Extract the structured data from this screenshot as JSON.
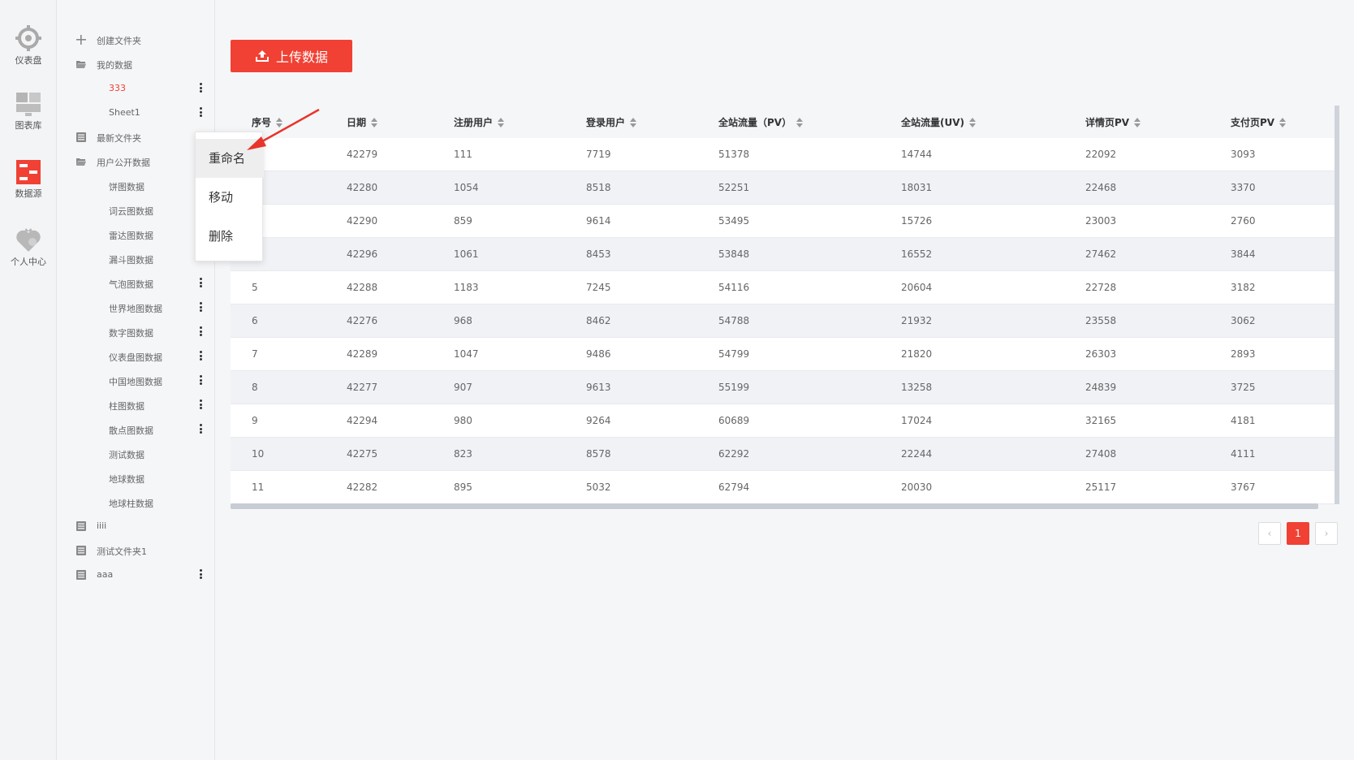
{
  "rail": {
    "items": [
      {
        "label": "仪表盘",
        "icon": "dashboard-icon"
      },
      {
        "label": "图表库",
        "icon": "chart-library-icon"
      },
      {
        "label": "数据源",
        "icon": "data-source-icon"
      },
      {
        "label": "个人中心",
        "icon": "user-center-icon"
      }
    ]
  },
  "tree": {
    "create_folder": "创建文件夹",
    "items": [
      {
        "label": "我的数据",
        "kind": "folder"
      },
      {
        "label": "333",
        "kind": "file"
      },
      {
        "label": "Sheet1",
        "kind": "file"
      },
      {
        "label": "最新文件夹",
        "kind": "list"
      },
      {
        "label": "用户公开数据",
        "kind": "folder"
      },
      {
        "label": "饼图数据",
        "kind": "file"
      },
      {
        "label": "词云图数据",
        "kind": "file"
      },
      {
        "label": "雷达图数据",
        "kind": "file"
      },
      {
        "label": "漏斗图数据",
        "kind": "file"
      },
      {
        "label": "气泡图数据",
        "kind": "file"
      },
      {
        "label": "世界地图数据",
        "kind": "file"
      },
      {
        "label": "数字图数据",
        "kind": "file"
      },
      {
        "label": "仪表盘图数据",
        "kind": "file"
      },
      {
        "label": "中国地图数据",
        "kind": "file"
      },
      {
        "label": "柱图数据",
        "kind": "file"
      },
      {
        "label": "散点图数据",
        "kind": "file"
      },
      {
        "label": "测试数据",
        "kind": "file"
      },
      {
        "label": "地球数据",
        "kind": "file"
      },
      {
        "label": "地球柱数据",
        "kind": "file"
      },
      {
        "label": "iiii",
        "kind": "list"
      },
      {
        "label": "测试文件夹1",
        "kind": "list"
      },
      {
        "label": "aaa",
        "kind": "list"
      }
    ]
  },
  "context_menu": {
    "items": [
      "重命名",
      "移动",
      "删除"
    ]
  },
  "upload": {
    "label": "上传数据"
  },
  "table": {
    "headers": [
      "序号",
      "日期",
      "注册用户",
      "登录用户",
      "全站流量（PV）",
      "全站流量(UV)",
      "详情页PV",
      "支付页PV"
    ],
    "rows": [
      [
        "",
        "42279",
        "111",
        "7719",
        "51378",
        "14744",
        "22092",
        "3093"
      ],
      [
        "",
        "42280",
        "1054",
        "8518",
        "52251",
        "18031",
        "22468",
        "3370"
      ],
      [
        "",
        "42290",
        "859",
        "9614",
        "53495",
        "15726",
        "23003",
        "2760"
      ],
      [
        "",
        "42296",
        "1061",
        "8453",
        "53848",
        "16552",
        "27462",
        "3844"
      ],
      [
        "5",
        "42288",
        "1183",
        "7245",
        "54116",
        "20604",
        "22728",
        "3182"
      ],
      [
        "6",
        "42276",
        "968",
        "8462",
        "54788",
        "21932",
        "23558",
        "3062"
      ],
      [
        "7",
        "42289",
        "1047",
        "9486",
        "54799",
        "21820",
        "26303",
        "2893"
      ],
      [
        "8",
        "42277",
        "907",
        "9613",
        "55199",
        "13258",
        "24839",
        "3725"
      ],
      [
        "9",
        "42294",
        "980",
        "9264",
        "60689",
        "17024",
        "32165",
        "4181"
      ],
      [
        "10",
        "42275",
        "823",
        "8578",
        "62292",
        "22244",
        "27408",
        "4111"
      ],
      [
        "11",
        "42282",
        "895",
        "5032",
        "62794",
        "20030",
        "25117",
        "3767"
      ]
    ]
  },
  "pager": {
    "prev": "‹",
    "current": "1",
    "next": "›"
  },
  "colors": {
    "accent": "#f04134"
  }
}
